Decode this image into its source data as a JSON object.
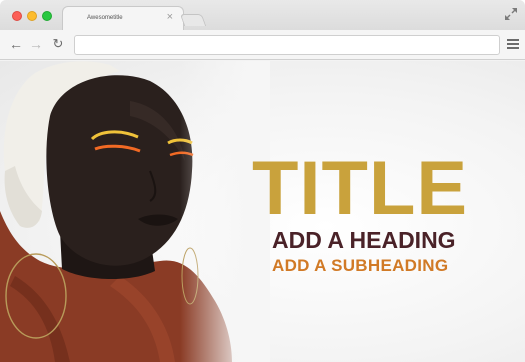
{
  "browser": {
    "tab_title": "Awesometitle",
    "tab_close": "×",
    "address_value": "",
    "icons": {
      "back": "arrow-left-icon",
      "forward": "arrow-right-icon",
      "reload": "reload-icon",
      "menu": "hamburger-menu-icon",
      "expand": "expand-icon"
    }
  },
  "hero": {
    "title": "TITLE",
    "heading": "ADD A HEADING",
    "subheading": "ADD A SUBHEADING"
  },
  "colors": {
    "title": "#c9a23c",
    "heading": "#4a2228",
    "subheading": "#d17a26",
    "scarf": "#8a3b25",
    "head_wrap": "#f1efe9"
  }
}
